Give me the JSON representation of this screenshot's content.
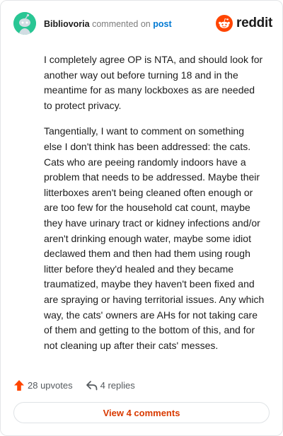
{
  "comment": {
    "username": "Bibliovoria",
    "commented_text": "commented on",
    "post_link_text": "post",
    "brand_name": "reddit",
    "paragraphs": [
      "I completely agree OP is NTA, and should look for another way out before turning 18 and in the meantime for as many lockboxes as are needed to protect privacy.",
      "Tangentially, I want to comment on something else I don't think has been addressed: the cats. Cats who are peeing randomly indoors have a problem that needs to be addressed. Maybe their litterboxes aren't being cleaned often enough or are too few for the household cat count, maybe they have urinary tract or kidney infections and/or aren't drinking enough water, maybe some idiot declawed them and then had them using rough litter before they'd healed and they became traumatized, maybe they haven't been fixed and are spraying or having territorial issues. Any which way, the cats' owners are AHs for not taking care of them and getting to the bottom of this, and for not cleaning up after their cats' messes."
    ]
  },
  "actions": {
    "upvotes_label": "28 upvotes",
    "replies_label": "4 replies"
  },
  "footer": {
    "view_comments_label": "View 4 comments"
  },
  "icons": {
    "avatar": "snoo-avatar-icon",
    "brand_logo": "reddit-logo-icon",
    "upvote": "upvote-arrow-icon",
    "reply": "reply-arrow-icon"
  },
  "colors": {
    "brand_orange": "#ff4500",
    "link_blue": "#0079d3",
    "view_comments": "#d93a00",
    "avatar_bg": "#29c694"
  }
}
